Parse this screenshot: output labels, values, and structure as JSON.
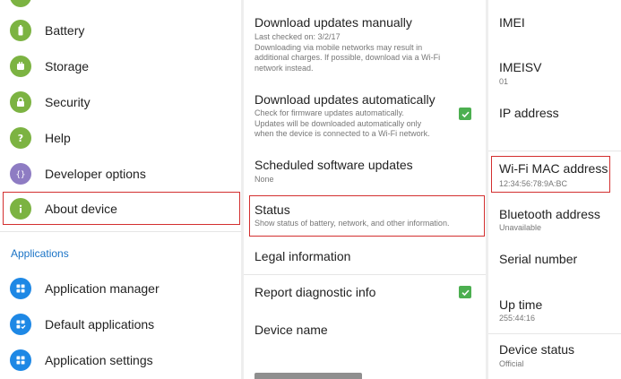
{
  "colors": {
    "battery": "#7cb342",
    "storage": "#7cb342",
    "security": "#7cb342",
    "help": "#7cb342",
    "developer": "#8e7cc3",
    "about": "#7cb342",
    "apps": "#1e88e5",
    "check": "#4caf50",
    "highlight": "#d32f2f",
    "section": "#1a73c6"
  },
  "left": {
    "items": [
      {
        "label": "Battery",
        "icon": "battery-icon"
      },
      {
        "label": "Storage",
        "icon": "storage-icon"
      },
      {
        "label": "Security",
        "icon": "lock-icon"
      },
      {
        "label": "Help",
        "icon": "help-icon"
      },
      {
        "label": "Developer options",
        "icon": "braces-icon"
      },
      {
        "label": "About device",
        "icon": "info-icon"
      }
    ],
    "section_header": "Applications",
    "app_items": [
      {
        "label": "Application manager",
        "icon": "apps-grid-icon"
      },
      {
        "label": "Default applications",
        "icon": "apps-grid-check-icon"
      },
      {
        "label": "Application settings",
        "icon": "apps-grid-icon"
      }
    ]
  },
  "middle": {
    "items": [
      {
        "title": "Download updates manually",
        "lines": [
          "Last checked on: 3/2/17",
          "Downloading via mobile networks may result in",
          "additional charges. If possible, download via a Wi-Fi",
          "network instead."
        ]
      },
      {
        "title": "Download updates automatically",
        "lines": [
          "Check for firmware updates automatically.",
          "Updates will be downloaded automatically only",
          "when the device is connected to a Wi-Fi network."
        ],
        "checked": true
      },
      {
        "title": "Scheduled software updates",
        "lines": [
          "None"
        ]
      },
      {
        "title": "Status",
        "lines": [
          "Show status of battery, network, and other information."
        ]
      },
      {
        "title": "Legal information"
      },
      {
        "title": "Report diagnostic info",
        "checked": true
      },
      {
        "title": "Device name"
      }
    ]
  },
  "right": {
    "items": [
      {
        "title": "IMEI",
        "value": ""
      },
      {
        "title": "IMEISV",
        "value": "01"
      },
      {
        "title": "IP address",
        "value": ""
      },
      {
        "title": "Wi-Fi MAC address",
        "value": "12:34:56:78:9A:BC"
      },
      {
        "title": "Bluetooth address",
        "value": "Unavailable"
      },
      {
        "title": "Serial number",
        "value": ""
      },
      {
        "title": "Up time",
        "value": "255:44:16"
      },
      {
        "title": "Device status",
        "value": "Official"
      }
    ]
  }
}
